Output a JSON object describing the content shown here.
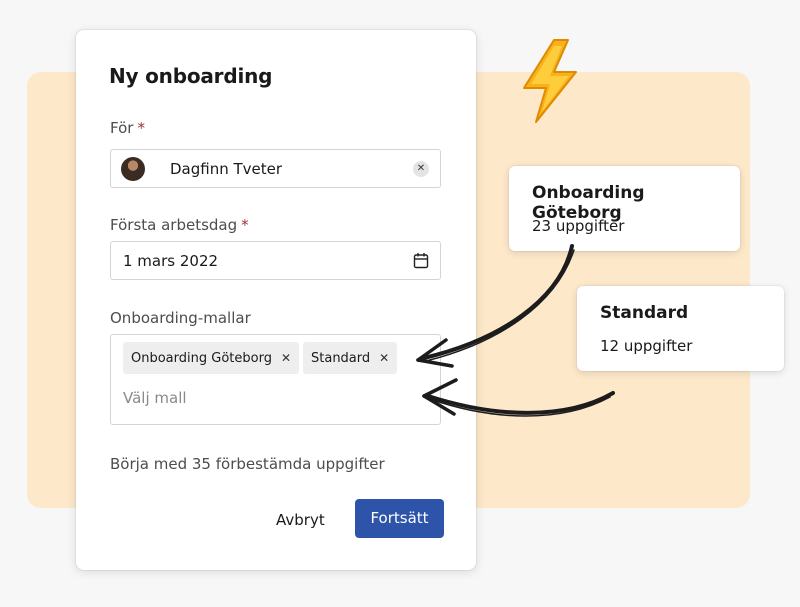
{
  "dialog": {
    "title": "Ny onboarding",
    "for_label": "För",
    "required_mark": "*",
    "person": {
      "name": "Dagfinn Tveter"
    },
    "clear_glyph": "✕",
    "first_day_label": "Första arbetsdag",
    "first_day_value": "1 mars 2022",
    "templates_label": "Onboarding-mallar",
    "template_chips": [
      {
        "label": "Onboarding Göteborg",
        "remove": "✕"
      },
      {
        "label": "Standard",
        "remove": "✕"
      }
    ],
    "templates_placeholder": "Välj mall",
    "hint": "Börja med 35 förbestämda uppgifter",
    "cancel_label": "Avbryt",
    "continue_label": "Fortsätt"
  },
  "cards": [
    {
      "title": "Onboarding Göteborg",
      "subtitle": "23 uppgifter"
    },
    {
      "title": "Standard",
      "subtitle": "12 uppgifter"
    }
  ],
  "colors": {
    "backdrop": "#fde8ca",
    "primary": "#2d54a8",
    "required": "#a32f3c",
    "bolt": "#f7b21b"
  },
  "icons": [
    "calendar-icon",
    "clear-icon",
    "close-icon",
    "lightning-icon",
    "curved-arrow-icon"
  ]
}
